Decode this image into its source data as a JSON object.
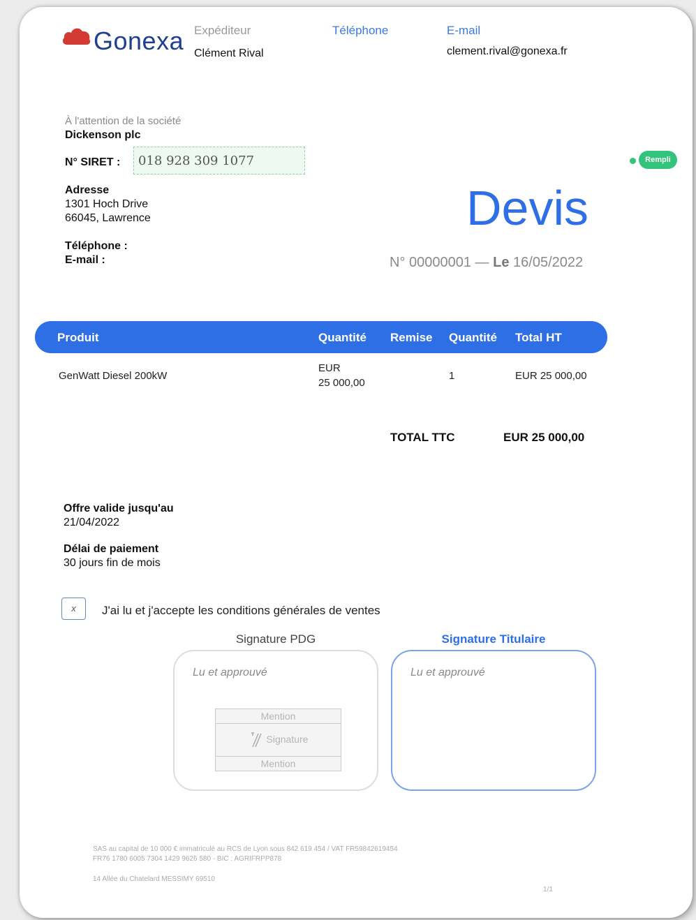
{
  "brand": {
    "name": "Gonexa",
    "color": "#1f3f8f",
    "icon": "cloud-logo-icon"
  },
  "header": {
    "sender_label": "Expéditeur",
    "sender_value": "Clément Rival",
    "phone_label": "Téléphone",
    "email_label": "E-mail",
    "email_value": "clement.rival@gonexa.fr"
  },
  "recipient": {
    "attention_label": "À l'attention de la société",
    "company": "Dickenson plc",
    "siret_label": "N° SIRET :",
    "siret_value": "018 928 309 1077",
    "address_label": "Adresse",
    "address_line1": "1301 Hoch Drive",
    "address_line2": "66045, Lawrence",
    "phone_label": "Téléphone :",
    "email_label": "E-mail :"
  },
  "badge": {
    "label": "Rempli",
    "color": "#33c47c"
  },
  "devis": {
    "title": "Devis",
    "number": "N° 00000001",
    "separator": "—",
    "date_label": "Le",
    "date_value": "16/05/2022"
  },
  "table": {
    "headers": [
      "Produit",
      "Quantité",
      "Remise",
      "Quantité",
      "Total HT"
    ],
    "row": {
      "product": "GenWatt Diesel 200kW",
      "price_currency": "EUR",
      "price_amount": "25 000,00",
      "quantity": "1",
      "total": "EUR 25 000,00"
    },
    "total_label": "TOTAL TTC",
    "total_value": "EUR 25 000,00"
  },
  "terms": {
    "validity_label": "Offre valide jusqu'au",
    "validity_value": "21/04/2022",
    "payment_label": "Délai de paiement",
    "payment_value": "30 jours fin de mois"
  },
  "cgv": {
    "checkbox_mark": "x",
    "label": "J'ai lu et j'accepte les conditions générales de ventes"
  },
  "signatures": {
    "pdg_title": "Signature PDG",
    "pdg_placeholder": "Lu et approuvé",
    "mention_top": "Mention",
    "signature_label": "Signature",
    "mention_bottom": "Mention",
    "holder_title": "Signature Titulaire",
    "holder_placeholder": "Lu et approuvé"
  },
  "footer": {
    "line1": "SAS au capital de 10 000 € immatriculé au RCS de Lyon sous 842 619 454 / VAT FR59842619454",
    "line2": "FR76 1780 6005 7304 1429 9626 580 - BIC : AGRIFRPP878",
    "line3": "14 Allée du Chatelard MESSIMY 69510",
    "page": "1/1"
  },
  "colors": {
    "accent": "#2e6fe6",
    "muted": "#8a8a8a"
  }
}
